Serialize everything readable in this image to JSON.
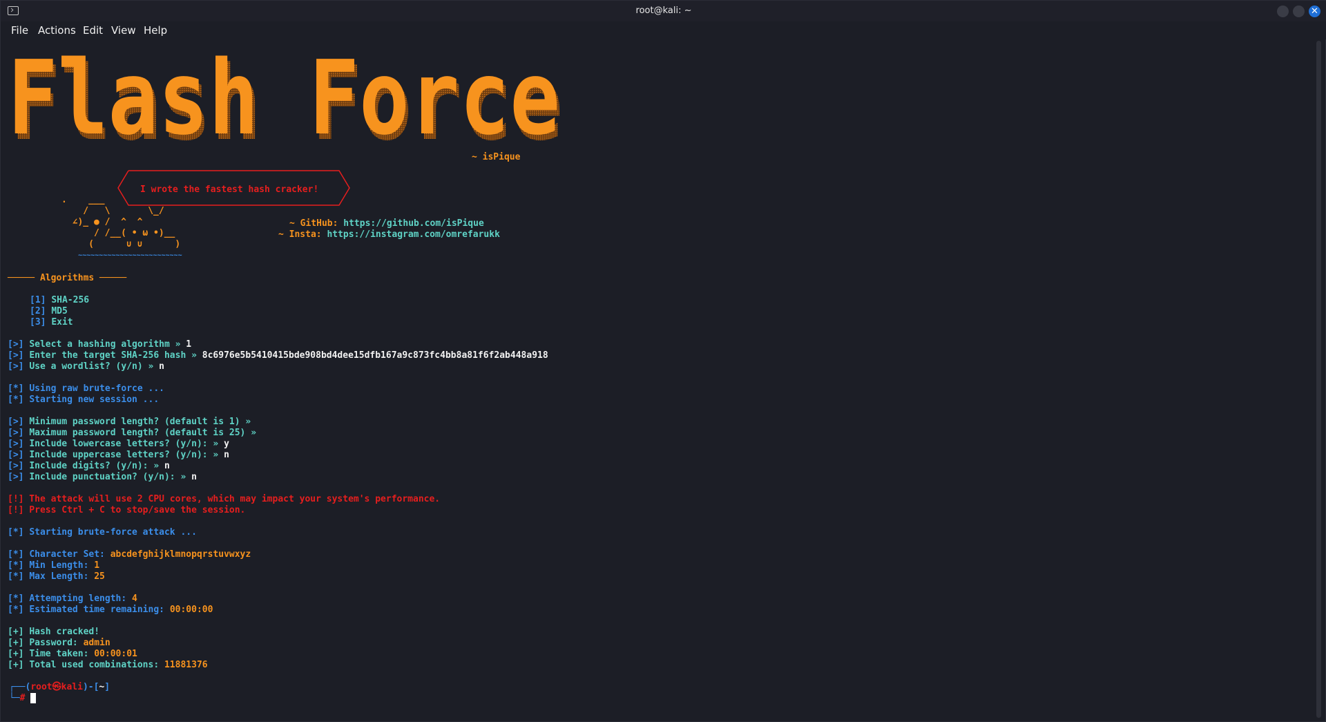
{
  "window": {
    "title": "root@kali: ~"
  },
  "menu": [
    "File",
    "Actions",
    "Edit",
    "View",
    "Help"
  ],
  "banner": {
    "text": "Flash Force",
    "author": "~ isPique"
  },
  "art": {
    "bubble_text": "I wrote the fastest hash cracker!",
    "github_label": "~ GitHub:",
    "github_url": "https://github.com/isPique",
    "insta_label": "~ Insta:",
    "insta_url": "https://instagram.com/omrefarukk",
    "cat_lines": [
      ".    ___",
      "    /   \\       \\_/",
      "  ∠)_ ● /  ^  ^",
      "      / /__( • ω •)__",
      "     (      ∪ ∪      )",
      "    ~~~~~~~~~~~~~~~~~~~~~~~~~"
    ]
  },
  "algorithms": {
    "header": "───── Algorithms ─────",
    "items": [
      {
        "key": "[1]",
        "label": "SHA-256"
      },
      {
        "key": "[2]",
        "label": "MD5"
      },
      {
        "key": "[3]",
        "label": "Exit"
      }
    ]
  },
  "session": {
    "prompts": [
      {
        "tag": "[>]",
        "text": "Select a hashing algorithm » ",
        "answer": "1"
      },
      {
        "tag": "[>]",
        "text": "Enter the target SHA-256 hash » ",
        "answer": "8c6976e5b5410415bde908bd4dee15dfb167a9c873fc4bb8a81f6f2ab448a918"
      },
      {
        "tag": "[>]",
        "text": "Use a wordlist? (y/n) » ",
        "answer": "n"
      }
    ],
    "info1": [
      {
        "tag": "[*]",
        "text": "Using raw brute-force ..."
      },
      {
        "tag": "[*]",
        "text": "Starting new session ..."
      }
    ],
    "options": [
      {
        "tag": "[>]",
        "text": "Minimum password length? (default is 1) » ",
        "answer": ""
      },
      {
        "tag": "[>]",
        "text": "Maximum password length? (default is 25) » ",
        "answer": ""
      },
      {
        "tag": "[>]",
        "text": "Include lowercase letters? (y/n): » ",
        "answer": "y"
      },
      {
        "tag": "[>]",
        "text": "Include uppercase letters? (y/n): » ",
        "answer": "n"
      },
      {
        "tag": "[>]",
        "text": "Include digits? (y/n): » ",
        "answer": "n"
      },
      {
        "tag": "[>]",
        "text": "Include punctuation? (y/n): » ",
        "answer": "n"
      }
    ],
    "warnings": [
      "[!] The attack will use 2 CPU cores, which may impact your system's performance.",
      "[!] Press Ctrl + C to stop/save the session."
    ],
    "start": {
      "tag": "[*]",
      "text": "Starting brute-force attack ..."
    },
    "config": [
      {
        "tag": "[*]",
        "label": "Character Set: ",
        "value": "abcdefghijklmnopqrstuvwxyz"
      },
      {
        "tag": "[*]",
        "label": "Min Length: ",
        "value": "1"
      },
      {
        "tag": "[*]",
        "label": "Max Length: ",
        "value": "25"
      }
    ],
    "progress": [
      {
        "tag": "[*]",
        "label": "Attempting length: ",
        "value": "4"
      },
      {
        "tag": "[*]",
        "label": "Estimated time remaining: ",
        "value": "00:00:00"
      }
    ],
    "result": [
      {
        "tag": "[+]",
        "label": "Hash cracked!",
        "value": ""
      },
      {
        "tag": "[+]",
        "label": "Password: ",
        "value": "admin"
      },
      {
        "tag": "[+]",
        "label": "Time taken: ",
        "value": "00:00:01"
      },
      {
        "tag": "[+]",
        "label": "Total used combinations: ",
        "value": "11881376"
      }
    ]
  },
  "prompt": {
    "open": "┌──(",
    "user": "root㉿kali",
    "mid": ")-[",
    "dir": "~",
    "close": "]",
    "second": "└─",
    "symbol": "#"
  }
}
